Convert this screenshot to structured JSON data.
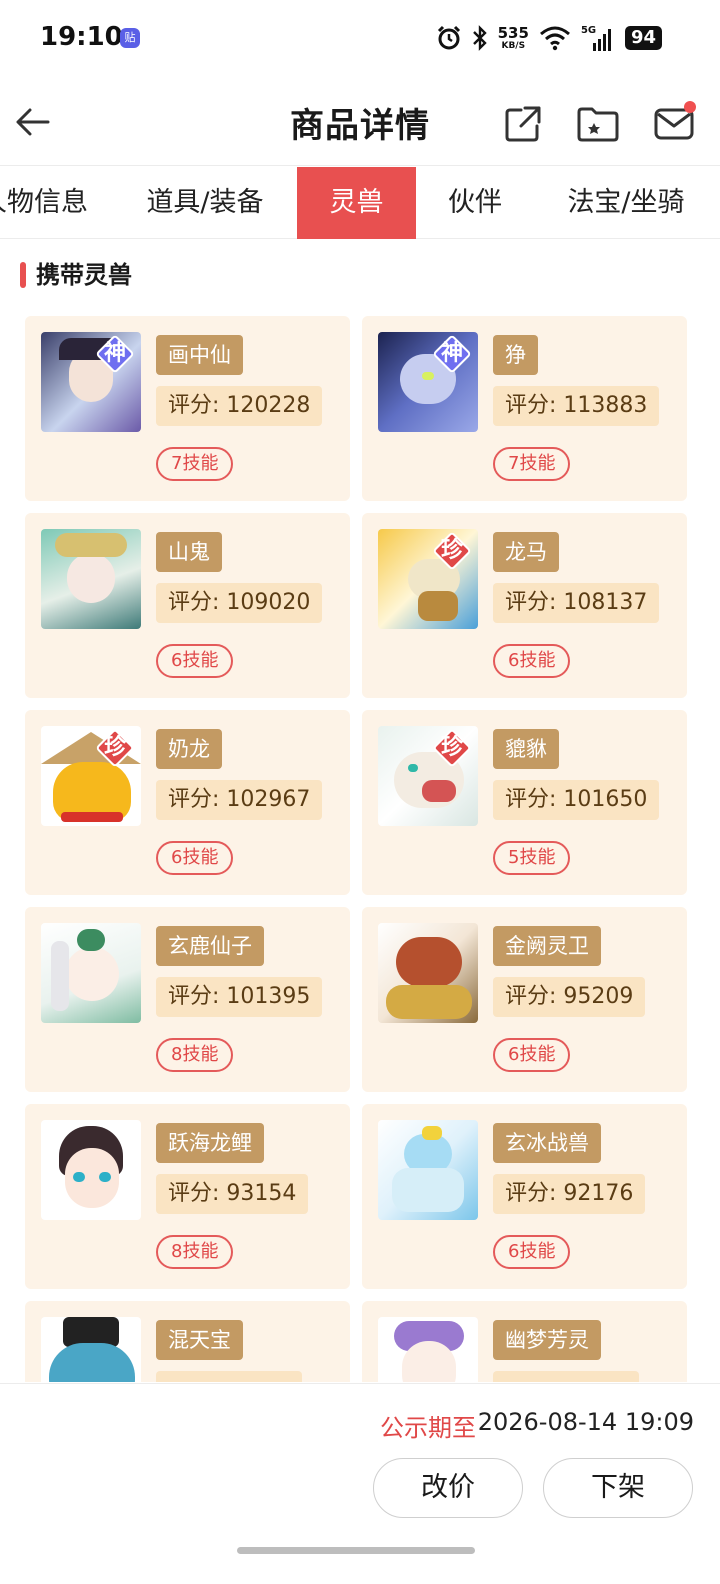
{
  "status": {
    "time": "19:10",
    "app_badge": "贴",
    "net_speed_value": "535",
    "net_speed_unit": "KB/S",
    "network": "5G",
    "battery": "94"
  },
  "header": {
    "title": "商品详情"
  },
  "tabs": [
    {
      "label": "人物信息"
    },
    {
      "label": "道具/装备"
    },
    {
      "label": "灵兽",
      "active": true
    },
    {
      "label": "伙伴"
    },
    {
      "label": "法宝/坐骑"
    }
  ],
  "section": {
    "title": "携带灵兽"
  },
  "beasts": [
    {
      "name": "画中仙",
      "score": "评分: 120228",
      "skills": "7技能",
      "badge": "神",
      "badge_color": "#6f6ff0"
    },
    {
      "name": "狰",
      "score": "评分: 113883",
      "skills": "7技能",
      "badge": "神",
      "badge_color": "#6f6ff0"
    },
    {
      "name": "山鬼",
      "score": "评分: 109020",
      "skills": "6技能",
      "badge": "",
      "badge_color": ""
    },
    {
      "name": "龙马",
      "score": "评分: 108137",
      "skills": "6技能",
      "badge": "珍",
      "badge_color": "#e04848"
    },
    {
      "name": "奶龙",
      "score": "评分: 102967",
      "skills": "6技能",
      "badge": "珍",
      "badge_color": "#e04848"
    },
    {
      "name": "貔貅",
      "score": "评分: 101650",
      "skills": "5技能",
      "badge": "珍",
      "badge_color": "#e04848"
    },
    {
      "name": "玄鹿仙子",
      "score": "评分: 101395",
      "skills": "8技能",
      "badge": "",
      "badge_color": ""
    },
    {
      "name": "金阙灵卫",
      "score": "评分: 95209",
      "skills": "6技能",
      "badge": "",
      "badge_color": ""
    },
    {
      "name": "跃海龙鲤",
      "score": "评分: 93154",
      "skills": "8技能",
      "badge": "",
      "badge_color": ""
    },
    {
      "name": "玄冰战兽",
      "score": "评分: 92176",
      "skills": "6技能",
      "badge": "",
      "badge_color": ""
    },
    {
      "name": "混天宝",
      "score": "",
      "skills": "",
      "badge": "",
      "badge_color": ""
    },
    {
      "name": "幽梦芳灵",
      "score": "",
      "skills": "",
      "badge": "",
      "badge_color": ""
    }
  ],
  "footer": {
    "publicity_label": "公示期至",
    "publicity_date": "2026-08-14 19:09",
    "change_price_label": "改价",
    "delist_label": "下架"
  },
  "colors": {
    "accent": "#e85050",
    "card_bg": "#fdf3e7",
    "name_tag": "#c39a63",
    "score_tag": "#fae4c3"
  }
}
